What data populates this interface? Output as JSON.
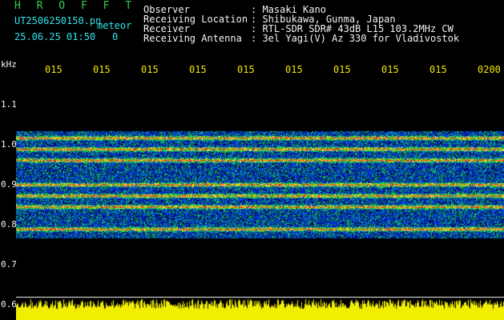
{
  "header": {
    "title": "H R O F F T",
    "filename": "UT2506250150.pn",
    "timestamp": "25.06.25 01:50",
    "meteor_label": "meteor",
    "meteor_count": "0"
  },
  "info": {
    "fields": [
      {
        "label": "Observer",
        "value": ": Masaki Kano"
      },
      {
        "label": "Receiving Location",
        "value": ": Shibukawa, Gunma, Japan"
      },
      {
        "label": "Receiver",
        "value": ": RTL-SDR SDR# 43dB L15 103.2MHz CW"
      },
      {
        "label": "Receiving Antenna",
        "value": ": 3el Yagi(V) Az 330 for Vladivostok"
      }
    ]
  },
  "axis": {
    "unit": "kHz",
    "y_ticks": [
      "1.1",
      "1.0",
      "0.9",
      "0.8",
      "0.7",
      "0.6"
    ],
    "x_ticks": [
      "015",
      "015",
      "015",
      "015",
      "015",
      "015",
      "015",
      "015",
      "015",
      "0200"
    ]
  },
  "spectrogram": {
    "freq_range_khz": [
      0.58,
      1.12
    ],
    "signal_bands_khz": [
      0.99,
      0.965,
      0.94,
      0.885,
      0.86,
      0.835,
      0.785
    ],
    "colors": {
      "background": "#000000",
      "noise_low": "#0000c8",
      "signal_mid": "#18e018",
      "signal_high": "#ff1818",
      "marker_line": "#ffffff",
      "level_meter": "#f2ee00"
    }
  }
}
